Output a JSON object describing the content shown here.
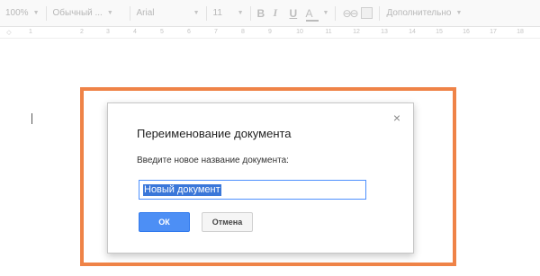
{
  "toolbar": {
    "zoom": "100%",
    "style": "Обычный ...",
    "font": "Arial",
    "size": "11",
    "bold": "B",
    "italic": "I",
    "underline": "U",
    "text_color": "A",
    "link": "⊖⊖",
    "more": "Дополнительно"
  },
  "ruler": {
    "numbers": [
      "1",
      "2",
      "3",
      "4",
      "5",
      "6",
      "7",
      "8",
      "9",
      "10",
      "11",
      "12",
      "13",
      "14",
      "15",
      "16",
      "17",
      "18"
    ]
  },
  "dialog": {
    "title": "Переименование документа",
    "label": "Введите новое название документа:",
    "input_value": "Новый документ",
    "ok_label": "ОК",
    "cancel_label": "Отмена",
    "close_icon": "×"
  },
  "colors": {
    "highlight_frame": "#ef8347",
    "ok_button": "#4d8ff5",
    "selection": "#3a77d9"
  }
}
